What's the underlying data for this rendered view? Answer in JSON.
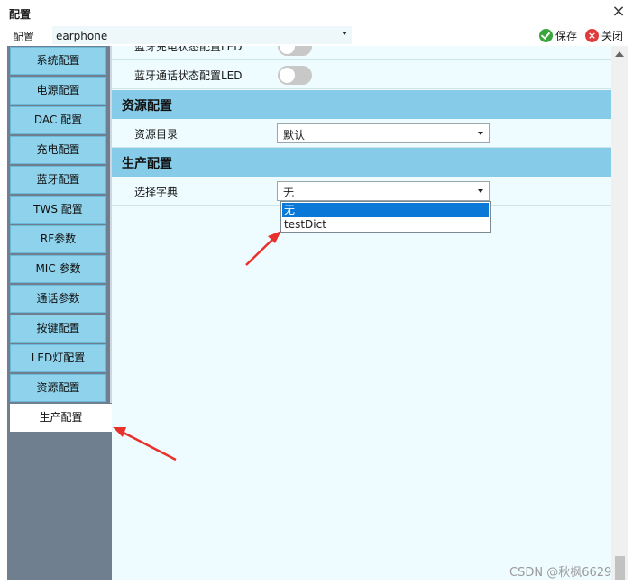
{
  "window": {
    "title": "配置",
    "close_glyph": "×"
  },
  "toolbar": {
    "label": "配置",
    "project_value": "earphone",
    "save_label": "保存",
    "close_label": "关闭"
  },
  "sidebar": {
    "items": [
      {
        "label": "系统配置"
      },
      {
        "label": "电源配置"
      },
      {
        "label": "DAC 配置"
      },
      {
        "label": "充电配置"
      },
      {
        "label": "蓝牙配置"
      },
      {
        "label": "TWS 配置"
      },
      {
        "label": "RF参数"
      },
      {
        "label": "MIC 参数"
      },
      {
        "label": "通话参数"
      },
      {
        "label": "按键配置"
      },
      {
        "label": "LED灯配置"
      },
      {
        "label": "资源配置"
      },
      {
        "label": "生产配置"
      }
    ],
    "active_index": 12
  },
  "main": {
    "row_partial": {
      "label": "蓝牙充电状态配置LED"
    },
    "row_call_led": {
      "label": "蓝牙通话状态配置LED"
    },
    "section_resource": {
      "title": "资源配置"
    },
    "resource_dir": {
      "label": "资源目录",
      "value": "默认"
    },
    "section_production": {
      "title": "生产配置"
    },
    "dict_select": {
      "label": "选择字典",
      "value": "无"
    },
    "dropdown_options": [
      {
        "label": "无",
        "selected": true
      },
      {
        "label": "testDict",
        "selected": false
      }
    ]
  },
  "colors": {
    "section_bg": "#86cbe7",
    "panel_bg": "#eefcff",
    "sidebar_bg": "#6f7f8f",
    "sidebar_item_bg": "#8fd2ec",
    "selection_blue": "#0a78d7",
    "annotation_red": "#e8302c"
  },
  "watermark": "CSDN @秋枫6629"
}
